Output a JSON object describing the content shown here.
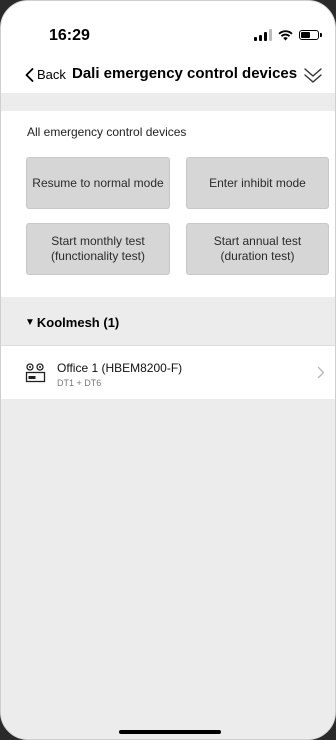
{
  "status_bar": {
    "time": "16:29"
  },
  "nav": {
    "back_label": "Back",
    "title": "Dali emergency control devices"
  },
  "all_devices": {
    "heading": "All emergency control devices",
    "buttons": {
      "resume": "Resume to normal mode",
      "inhibit": "Enter inhibit mode",
      "monthly": "Start monthly test\n(functionality test)",
      "annual": "Start annual test\n(duration test)"
    }
  },
  "group": {
    "name": "Koolmesh (1)",
    "devices": [
      {
        "name": "Office 1 (HBEM8200-F)",
        "types": "DT1 + DT6",
        "icon": "emergency-light-icon"
      }
    ]
  }
}
